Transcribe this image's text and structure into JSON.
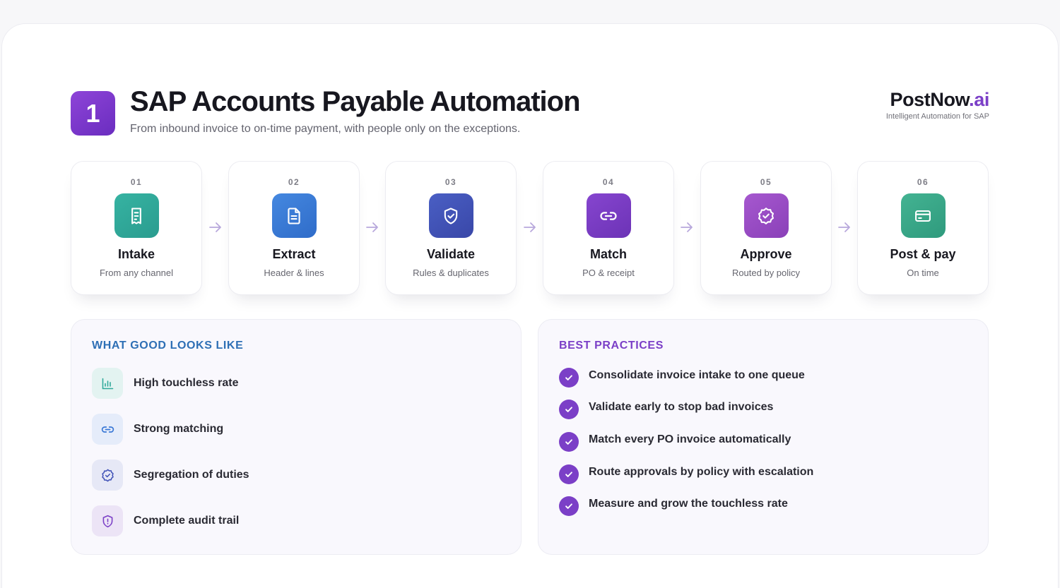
{
  "header": {
    "badge_number": "1",
    "title": "SAP Accounts Payable Automation",
    "subtitle": "From inbound invoice to on-time payment, with people only on the exceptions."
  },
  "brand": {
    "name_main": "PostNow",
    "name_suffix": ".ai",
    "tagline": "Intelligent Automation for SAP",
    "accent_color": "#7b3fc7"
  },
  "steps": [
    {
      "number": "01",
      "title": "Intake",
      "subtitle": "From any channel",
      "icon": "receipt-icon",
      "color": "#2fa99a"
    },
    {
      "number": "02",
      "title": "Extract",
      "subtitle": "Header & lines",
      "icon": "document-icon",
      "color": "#3a78d6"
    },
    {
      "number": "03",
      "title": "Validate",
      "subtitle": "Rules & duplicates",
      "icon": "shield-check-icon",
      "color": "#4354b8"
    },
    {
      "number": "04",
      "title": "Match",
      "subtitle": "PO & receipt",
      "icon": "link-icon",
      "color": "#7a3cc4"
    },
    {
      "number": "05",
      "title": "Approve",
      "subtitle": "Routed by policy",
      "icon": "badge-check-icon",
      "color": "#9a4ec3"
    },
    {
      "number": "06",
      "title": "Post & pay",
      "subtitle": "On time",
      "icon": "credit-card-icon",
      "color": "#3aa88a"
    }
  ],
  "good_panel": {
    "heading": "WHAT GOOD LOOKS LIKE",
    "heading_color": "#2e6fb5",
    "items": [
      {
        "label": "High touchless rate",
        "icon": "bar-chart-icon"
      },
      {
        "label": "Strong matching",
        "icon": "link-icon"
      },
      {
        "label": "Segregation of duties",
        "icon": "badge-check-icon"
      },
      {
        "label": "Complete audit trail",
        "icon": "shield-alert-icon"
      }
    ]
  },
  "practices_panel": {
    "heading": "BEST PRACTICES",
    "heading_color": "#7b3fc7",
    "items": [
      {
        "label": "Consolidate invoice intake to one queue"
      },
      {
        "label": "Validate early to stop bad invoices"
      },
      {
        "label": "Match every PO invoice automatically"
      },
      {
        "label": "Route approvals by policy with escalation"
      },
      {
        "label": "Measure and grow the touchless rate"
      }
    ]
  }
}
